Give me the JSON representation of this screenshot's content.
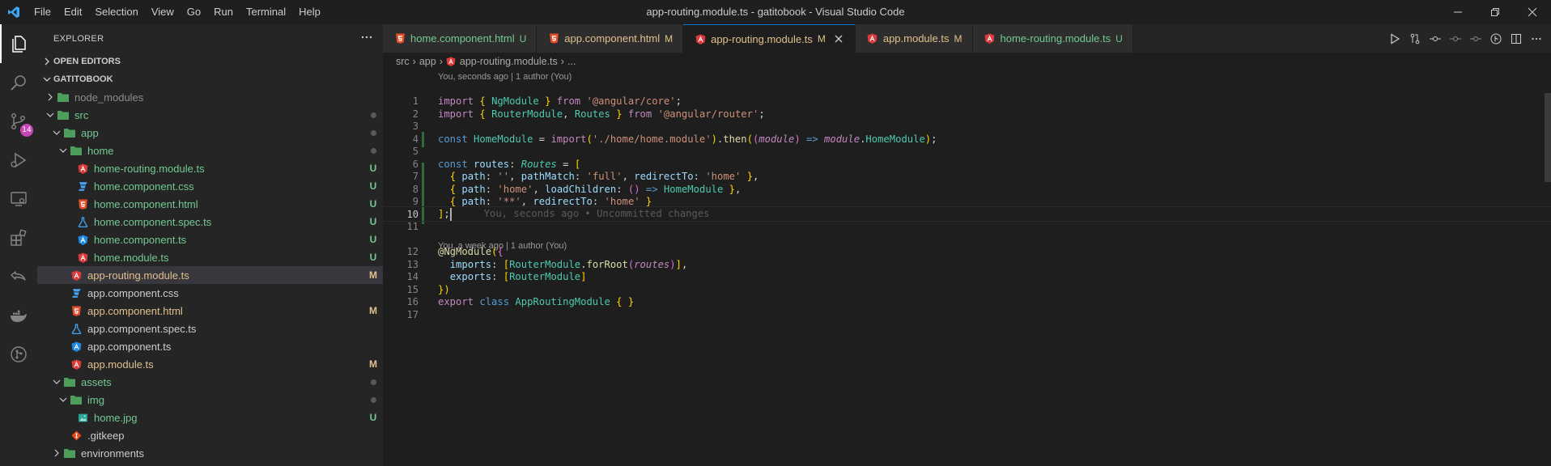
{
  "window": {
    "title": "app-routing.module.ts - gatitobook - Visual Studio Code",
    "menu": [
      "File",
      "Edit",
      "Selection",
      "View",
      "Go",
      "Run",
      "Terminal",
      "Help"
    ]
  },
  "activity_bar": {
    "items": [
      "explorer-icon",
      "search-icon",
      "source-control-icon",
      "run-debug-icon",
      "remote-explorer-icon",
      "extensions-icon",
      "live-share-icon",
      "docker-icon",
      "git-graph-icon"
    ],
    "source_control_badge": "14"
  },
  "sidebar": {
    "header": "EXPLORER",
    "sections": {
      "open_editors": "OPEN EDITORS",
      "project": "GATITOBOOK"
    },
    "tree": [
      {
        "label": "node_modules",
        "type": "folder",
        "status": "",
        "tone": "gray"
      },
      {
        "label": "src",
        "type": "folder",
        "status": "dot",
        "tone": "green"
      },
      {
        "label": "app",
        "type": "folder",
        "status": "dot",
        "tone": "green"
      },
      {
        "label": "home",
        "type": "folder",
        "status": "dot",
        "tone": "green"
      },
      {
        "label": "home-routing.module.ts",
        "type": "angular",
        "status": "U",
        "tone": "green"
      },
      {
        "label": "home.component.css",
        "type": "css",
        "status": "U",
        "tone": "green"
      },
      {
        "label": "home.component.html",
        "type": "html",
        "status": "U",
        "tone": "green"
      },
      {
        "label": "home.component.spec.ts",
        "type": "spec",
        "status": "U",
        "tone": "green"
      },
      {
        "label": "home.component.ts",
        "type": "component",
        "status": "U",
        "tone": "green"
      },
      {
        "label": "home.module.ts",
        "type": "angular",
        "status": "U",
        "tone": "green"
      },
      {
        "label": "app-routing.module.ts",
        "type": "angular",
        "status": "M",
        "tone": "yellow"
      },
      {
        "label": "app.component.css",
        "type": "css",
        "status": "",
        "tone": "normal"
      },
      {
        "label": "app.component.html",
        "type": "html",
        "status": "M",
        "tone": "yellow"
      },
      {
        "label": "app.component.spec.ts",
        "type": "spec",
        "status": "",
        "tone": "normal"
      },
      {
        "label": "app.component.ts",
        "type": "component",
        "status": "",
        "tone": "normal"
      },
      {
        "label": "app.module.ts",
        "type": "angular",
        "status": "M",
        "tone": "yellow"
      },
      {
        "label": "assets",
        "type": "folder",
        "status": "dot",
        "tone": "green"
      },
      {
        "label": "img",
        "type": "folder",
        "status": "dot",
        "tone": "green"
      },
      {
        "label": "home.jpg",
        "type": "image",
        "status": "U",
        "tone": "green"
      },
      {
        "label": ".gitkeep",
        "type": "git",
        "status": "",
        "tone": "normal"
      },
      {
        "label": "environments",
        "type": "folder",
        "status": "",
        "tone": "normal"
      }
    ]
  },
  "tabs": [
    {
      "label": "home.component.html",
      "mark": "U",
      "icon": "html",
      "tone": "green"
    },
    {
      "label": "app.component.html",
      "mark": "M",
      "icon": "html",
      "tone": "yellow"
    },
    {
      "label": "app-routing.module.ts",
      "mark": "M",
      "icon": "angular",
      "tone": "yellow",
      "active": true
    },
    {
      "label": "app.module.ts",
      "mark": "M",
      "icon": "angular",
      "tone": "yellow"
    },
    {
      "label": "home-routing.module.ts",
      "mark": "U",
      "icon": "angular",
      "tone": "green"
    }
  ],
  "breadcrumb": [
    "src",
    "app",
    "app-routing.module.ts",
    "..."
  ],
  "codelens": {
    "top": "You, seconds ago | 1 author (You)",
    "middle": "You, a week ago | 1 author (You)"
  },
  "blame_inline": "You, seconds ago • Uncommitted changes",
  "line_numbers": [
    "1",
    "2",
    "3",
    "4",
    "5",
    "6",
    "7",
    "8",
    "9",
    "10",
    "11",
    "12",
    "13",
    "14",
    "15",
    "16",
    "17"
  ],
  "current_line": "10",
  "code_lines": [
    "import { NgModule } from '@angular/core';",
    "import { RouterModule, Routes } from '@angular/router';",
    "",
    "const HomeModule = import('./home/home.module').then((module) => module.HomeModule);",
    "",
    "const routes: Routes = [",
    "  { path: '', pathMatch: 'full', redirectTo: 'home' },",
    "  { path: 'home', loadChildren: () => HomeModule },",
    "  { path: '**', redirectTo: 'home' }",
    "];",
    "",
    "@NgModule({",
    "  imports: [RouterModule.forRoot(routes)],",
    "  exports: [RouterModule]",
    "})",
    "export class AppRoutingModule { }",
    ""
  ],
  "colors": {
    "accent": "#0078d4",
    "untracked": "#73c991",
    "modified": "#e2c08d",
    "badge": "#c746b8"
  }
}
